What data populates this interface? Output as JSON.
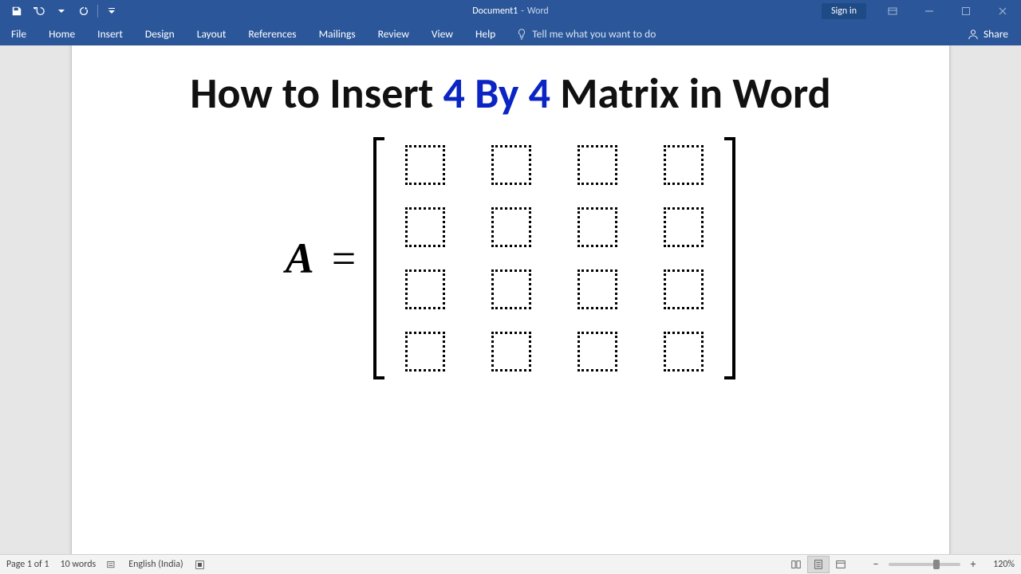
{
  "titlebar": {
    "document_name": "Document1",
    "app_name": "Word",
    "signin_label": "Sign in"
  },
  "ribbon": {
    "tabs": [
      "File",
      "Home",
      "Insert",
      "Design",
      "Layout",
      "References",
      "Mailings",
      "Review",
      "View",
      "Help"
    ],
    "tellme_placeholder": "Tell me what you want to do",
    "share_label": "Share"
  },
  "document": {
    "heading_parts": {
      "before": "How to Insert ",
      "highlight": "4 By 4",
      "after": " Matrix in Word"
    },
    "equation": {
      "lhs": "A",
      "op": "=",
      "matrix_rows": 4,
      "matrix_cols": 4
    }
  },
  "statusbar": {
    "page_info": "Page 1 of 1",
    "word_count": "10 words",
    "language": "English (India)",
    "zoom_percent": "120%"
  }
}
